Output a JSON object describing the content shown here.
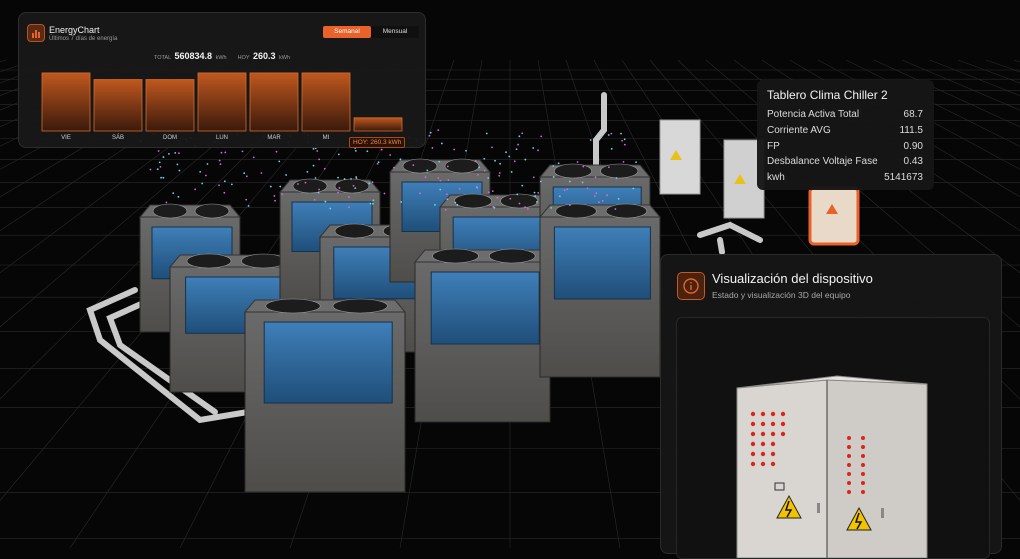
{
  "energy_chart": {
    "title": "EnergyChart",
    "subtitle": "Últimos 7 días de energía",
    "toggle": [
      "Semanal",
      "Mensual"
    ],
    "active_toggle": "Semanal",
    "total_label": "TOTAL",
    "total_value": "560834.8",
    "total_unit": "kWh",
    "today_label": "HOY",
    "today_value": "260.3",
    "today_unit": "kWh",
    "today_tag": "HOY: 260.3 kWh",
    "accent": "#e8622a"
  },
  "chart_data": {
    "type": "bar",
    "categories": [
      "VIE",
      "SÁB",
      "DOM",
      "LUN",
      "MAR",
      "MI"
    ],
    "values": [
      88,
      78,
      78,
      88,
      88,
      88,
      20
    ],
    "ylim": [
      0,
      100
    ],
    "grid": false
  },
  "device_info": {
    "title": "Tablero Clima Chiller 2",
    "rows": [
      {
        "label": "Potencia Activa Total",
        "value": "68.7"
      },
      {
        "label": "Corriente AVG",
        "value": "111.5"
      },
      {
        "label": "FP",
        "value": "0.90"
      },
      {
        "label": "Desbalance Voltaje Fase",
        "value": "0.43"
      },
      {
        "label": "kwh",
        "value": "5141673"
      }
    ]
  },
  "device_panel": {
    "title": "Visualización del dispositivo",
    "subtitle": "Estado y visualización 3D del equipo",
    "icon": "info-icon"
  }
}
